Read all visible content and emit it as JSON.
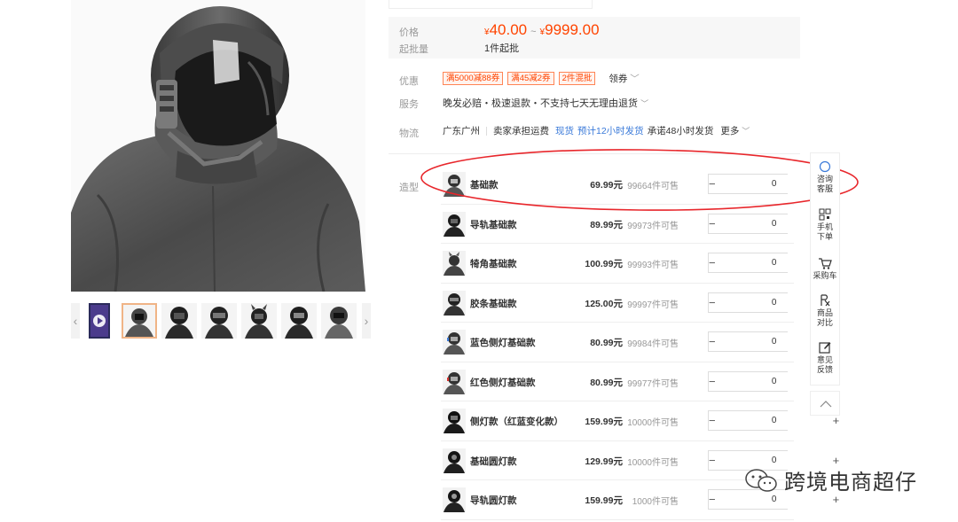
{
  "price_box": {
    "price_label": "价格",
    "min_label": "起批量",
    "currency": "¥",
    "price_low": "40.00",
    "separator": "~",
    "price_high": "9999.00",
    "min_qty": "1件起批"
  },
  "promo": {
    "label": "优惠",
    "coupons": [
      "满5000减88券",
      "满45减2券",
      "2件混批"
    ],
    "dropdown_label": "领券"
  },
  "service": {
    "label": "服务",
    "text": "晚发必赔・极速退款・不支持七天无理由退货"
  },
  "logistics": {
    "label": "物流",
    "origin": "广东广州",
    "shipping": "卖家承担运费",
    "stock_status": "现货",
    "eta": "预计12小时发货",
    "promise": "承诺48小时发货",
    "more": "更多"
  },
  "sku": {
    "label": "造型",
    "items": [
      {
        "name": "基础款",
        "price": "69.99元",
        "stock": "99664件可售",
        "qty": "0"
      },
      {
        "name": "导轨基础款",
        "price": "89.99元",
        "stock": "99973件可售",
        "qty": "0"
      },
      {
        "name": "犄角基础款",
        "price": "100.99元",
        "stock": "99993件可售",
        "qty": "0"
      },
      {
        "name": "胶条基础款",
        "price": "125.00元",
        "stock": "99997件可售",
        "qty": "0"
      },
      {
        "name": "蓝色侧灯基础款",
        "price": "80.99元",
        "stock": "99984件可售",
        "qty": "0"
      },
      {
        "name": "红色侧灯基础款",
        "price": "80.99元",
        "stock": "99977件可售",
        "qty": "0"
      },
      {
        "name": "侧灯款（红蓝变化款）",
        "price": "159.99元",
        "stock": "10000件可售",
        "qty": "0"
      },
      {
        "name": "基础圆灯款",
        "price": "129.99元",
        "stock": "10000件可售",
        "qty": "0"
      },
      {
        "name": "导轨圆灯款",
        "price": "159.99元",
        "stock": "1000件可售",
        "qty": "0"
      }
    ]
  },
  "toolbar": {
    "consult": [
      "咨询",
      "客服"
    ],
    "mobile": [
      "手机",
      "下单"
    ],
    "cart": "采购车",
    "compare": [
      "商品",
      "对比"
    ],
    "feedback": [
      "意见",
      "反馈"
    ]
  },
  "watermark": {
    "text": "跨境电商超仔"
  },
  "colors": {
    "price": "#ff4400",
    "blue_link": "#3a7ad9",
    "annotation": "#e8262b"
  }
}
